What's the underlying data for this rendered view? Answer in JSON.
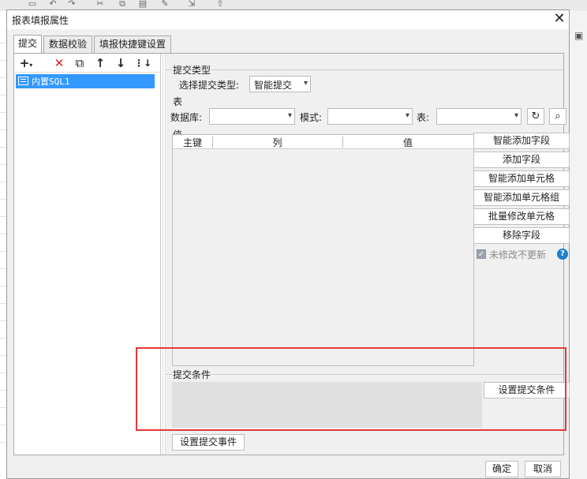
{
  "window": {
    "title": "报表填报属性"
  },
  "tabs": [
    {
      "label": "提交"
    },
    {
      "label": "数据校验"
    },
    {
      "label": "填报快捷键设置"
    }
  ],
  "tree": {
    "items": [
      {
        "label": "内置SQL1"
      }
    ]
  },
  "submit_type": {
    "legend": "提交类型",
    "label": "选择提交类型:",
    "value": "智能提交"
  },
  "table_section": {
    "legend": "表",
    "db_label": "数据库:",
    "mode_label": "模式:",
    "table_label": "表:"
  },
  "values_section": {
    "legend": "值",
    "columns": [
      "主键",
      "列",
      "值"
    ]
  },
  "side_buttons": {
    "smart_add_field": "智能添加字段",
    "add_field": "添加字段",
    "smart_add_cell": "智能添加单元格",
    "smart_add_cell_group": "智能添加单元格组",
    "batch_modify_cell": "批量修改单元格",
    "remove_field": "移除字段"
  },
  "no_update_unmodified": {
    "label": "未修改不更新",
    "checked": true
  },
  "submit_condition": {
    "legend": "提交条件",
    "button": "设置提交条件"
  },
  "set_submit_event": "设置提交事件",
  "footer": {
    "ok": "确定",
    "cancel": "取消"
  },
  "colors": {
    "selection": "#3399ff",
    "highlight_box": "#e53935",
    "help": "#1e7fd1"
  }
}
